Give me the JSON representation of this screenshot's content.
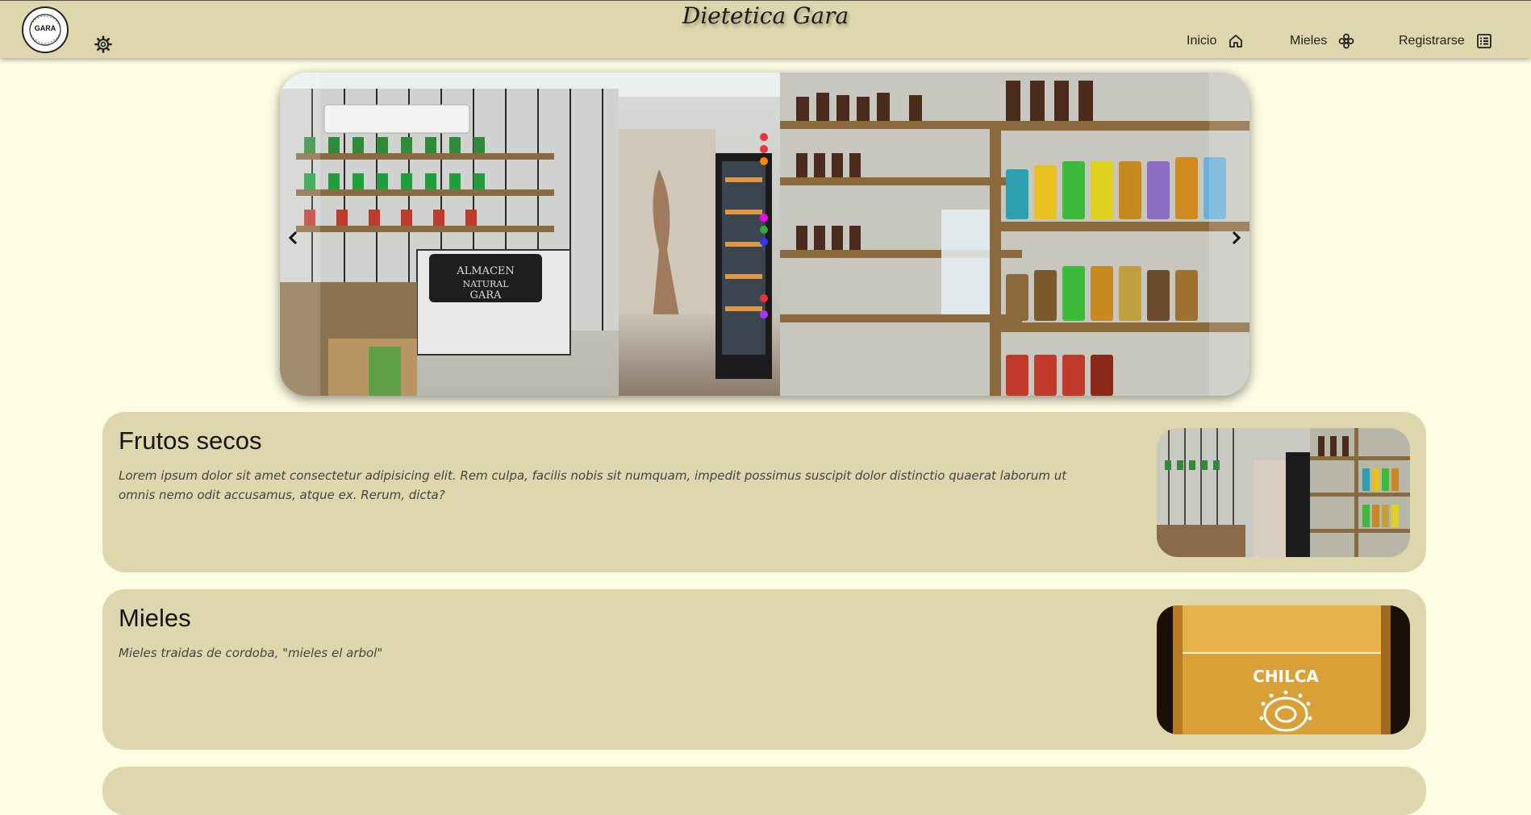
{
  "header": {
    "site_title": "Dietetica Gara",
    "logo_text": "GARA",
    "logo_ring_text": "ALMACEN NATURAL DIETETICA",
    "nav": [
      {
        "label": "Inicio",
        "icon": "home-icon"
      },
      {
        "label": "Mieles",
        "icon": "flower-icon"
      },
      {
        "label": "Registrarse",
        "icon": "list-icon"
      }
    ],
    "theme_icon": "gear-icon"
  },
  "carousel": {
    "sign_text": "ALMACEN NATURAL GARA",
    "prev_icon": "chevron-left-icon",
    "next_icon": "chevron-right-icon"
  },
  "cards": [
    {
      "title": "Frutos secos",
      "description": "Lorem ipsum dolor sit amet consectetur adipisicing elit. Rem culpa, facilis nobis sit numquam, impedit possimus suscipit dolor distinctio quaerat laborum ut omnis nemo odit accusamus, atque ex. Rerum, dicta?"
    },
    {
      "title": "Mieles",
      "description": "Mieles traidas de cordoba, \"mieles el arbol\"",
      "image_label": "CHILCA"
    }
  ],
  "colors": {
    "page_bg": "#fdfde4",
    "header_bg": "#ded6ad",
    "card_bg": "#ded6ad"
  }
}
